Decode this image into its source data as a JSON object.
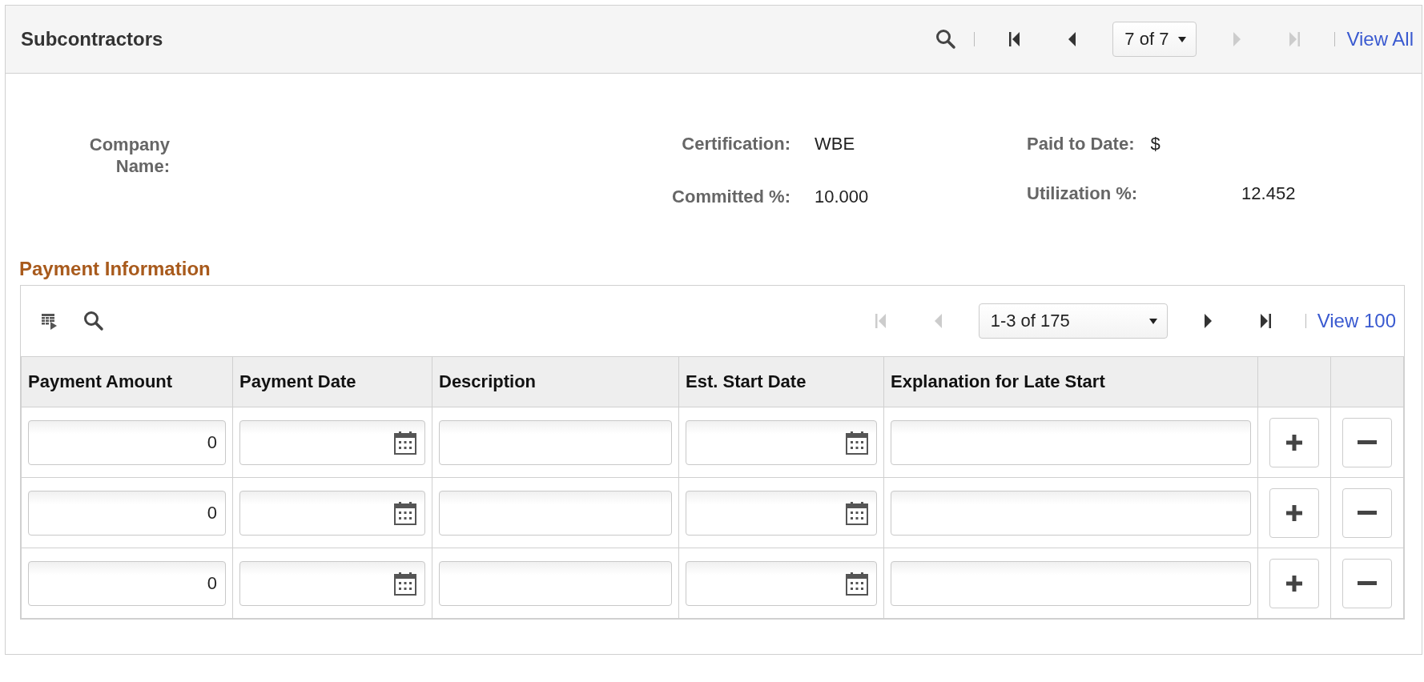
{
  "panel": {
    "title": "Subcontractors",
    "nav": [
      {
        "kind": "search"
      },
      {
        "kind": "first",
        "disabled": false
      },
      {
        "kind": "prev",
        "disabled": false
      },
      {
        "kind": "select",
        "value": "7 of 7"
      },
      {
        "kind": "next",
        "disabled": true
      },
      {
        "kind": "last",
        "disabled": true
      },
      {
        "kind": "link",
        "label": "View All"
      }
    ]
  },
  "fields": {
    "company_name": {
      "label": "Company Name:"
    },
    "certification": {
      "label": "Certification:",
      "value": "WBE"
    },
    "paid_to_date": {
      "label": "Paid to Date:",
      "value": "$"
    },
    "committed": {
      "label": "Committed %:",
      "value": "10.000"
    },
    "utilization": {
      "label": "Utilization %:",
      "value": "12.452"
    }
  },
  "grid": {
    "title": "Payment Information",
    "nav": [
      {
        "kind": "first",
        "disabled": true
      },
      {
        "kind": "prev",
        "disabled": true
      },
      {
        "kind": "select",
        "value": "1-3 of 175"
      },
      {
        "kind": "next",
        "disabled": false
      },
      {
        "kind": "last",
        "disabled": false
      },
      {
        "kind": "link",
        "label": "View 100"
      }
    ],
    "columns": [
      "Payment Amount",
      "Payment Date",
      "Description",
      "Est. Start Date",
      "Explanation for Late Start"
    ],
    "rows": [
      {
        "payment_amount": "0"
      },
      {
        "payment_amount": "0"
      },
      {
        "payment_amount": "0"
      }
    ]
  }
}
